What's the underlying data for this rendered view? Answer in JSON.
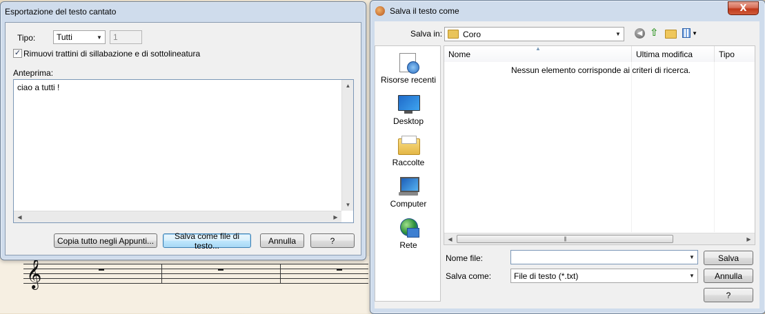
{
  "export_dialog": {
    "title": "Esportazione del testo cantato",
    "type_label": "Tipo:",
    "type_value": "Tutti",
    "number_value": "1",
    "remove_hyphens_label": "Rimuovi trattini di sillabazione e di sottolineatura",
    "remove_hyphens_checked": true,
    "preview_label": "Anteprima:",
    "preview_text": "ciao a tutti !",
    "buttons": {
      "copy_all": "Copia tutto negli Appunti...",
      "save_as_text": "Salva come file di testo...",
      "cancel": "Annulla",
      "help": "?"
    }
  },
  "save_dialog": {
    "title": "Salva il testo come",
    "close_label": "X",
    "save_in_label": "Salva in:",
    "save_in_value": "Coro",
    "places": [
      {
        "label": "Risorse recenti",
        "icon": "recent-places-icon"
      },
      {
        "label": "Desktop",
        "icon": "desktop-icon"
      },
      {
        "label": "Raccolte",
        "icon": "libraries-icon"
      },
      {
        "label": "Computer",
        "icon": "computer-icon"
      },
      {
        "label": "Rete",
        "icon": "network-icon"
      }
    ],
    "columns": [
      "Nome",
      "Ultima modifica",
      "Tipo"
    ],
    "empty_message": "Nessun elemento corrisponde ai criteri di ricerca.",
    "filename_label": "Nome file:",
    "filename_value": "",
    "save_as_label": "Salva come:",
    "save_as_value": "File di testo (*.txt)",
    "buttons": {
      "save": "Salva",
      "cancel": "Annulla",
      "help": "?"
    }
  }
}
